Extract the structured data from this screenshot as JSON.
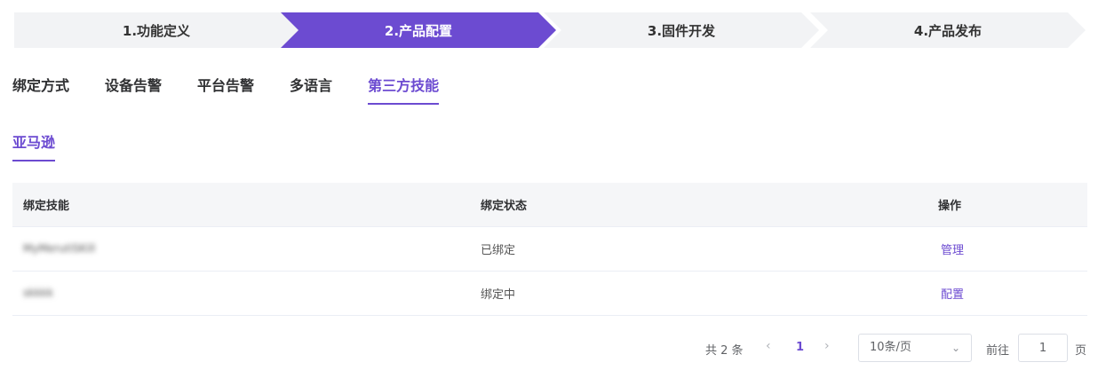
{
  "steps": [
    {
      "label": "1.功能定义",
      "active": false
    },
    {
      "label": "2.产品配置",
      "active": true
    },
    {
      "label": "3.固件开发",
      "active": false
    },
    {
      "label": "4.产品发布",
      "active": false
    }
  ],
  "colors": {
    "accent": "#6c4bd1",
    "step_inactive": "#f2f3f5"
  },
  "tabs": [
    "绑定方式",
    "设备告警",
    "平台告警",
    "多语言",
    "第三方技能"
  ],
  "subtab": "亚马逊",
  "table": {
    "headers": [
      "绑定技能",
      "绑定状态",
      "操作"
    ],
    "rows": [
      {
        "skill": "MyMerutiSKill",
        "status": "已绑定",
        "action": "管理"
      },
      {
        "skill": "skkkk",
        "status": "绑定中",
        "action": "配置"
      }
    ]
  },
  "pagination": {
    "total": "共 2 条",
    "prev_icon": "chevron-left-icon",
    "current_page": "1",
    "next_icon": "chevron-right-icon",
    "page_size": "10条/页",
    "goto_label": "前往",
    "goto_value": "1",
    "page_unit": "页"
  }
}
